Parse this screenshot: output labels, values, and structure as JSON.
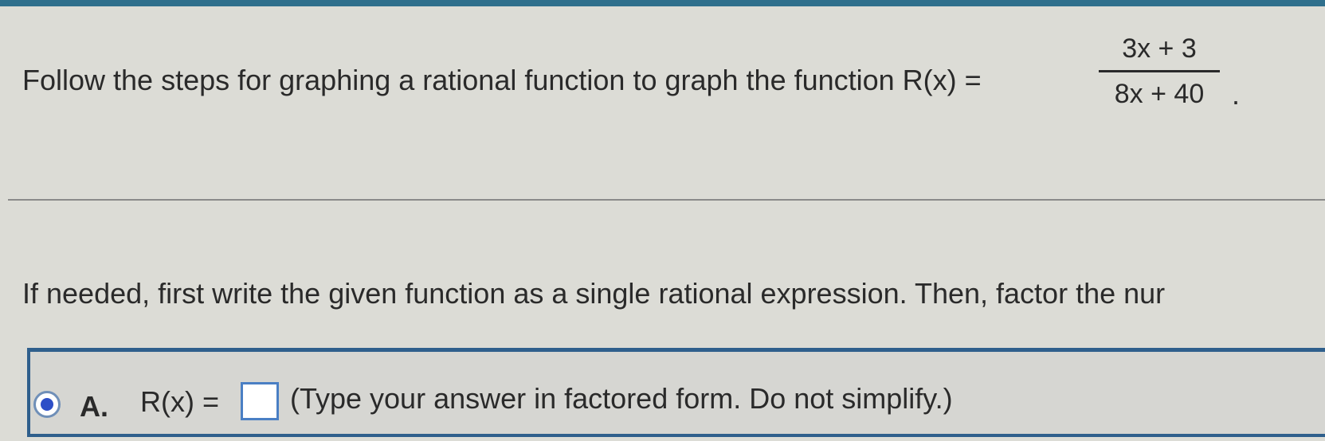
{
  "question": {
    "prompt": "Follow the steps for graphing a rational function to graph the function R(x) =",
    "numerator": "3x + 3",
    "denominator": "8x + 40",
    "period": "."
  },
  "instruction": "If needed, first write the given function as a single rational expression. Then, factor the nur",
  "options": [
    {
      "letter": "A.",
      "label": "R(x) =",
      "input_value": "",
      "hint": "(Type your answer in factored form. Do not simplify.)",
      "selected": true
    }
  ],
  "colors": {
    "accent": "#2f5f8c",
    "radio_selected": "#2d4fc7",
    "input_border": "#4a7fc4"
  }
}
